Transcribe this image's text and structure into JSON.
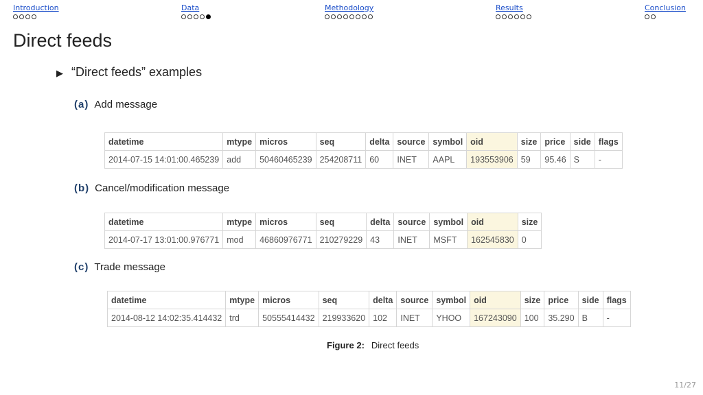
{
  "nav": [
    {
      "label": "Introduction",
      "dots": 4,
      "active": -1
    },
    {
      "label": "Data",
      "dots": 5,
      "active": 4
    },
    {
      "label": "Methodology",
      "dots": 8,
      "active": -1
    },
    {
      "label": "Results",
      "dots": 6,
      "active": -1
    },
    {
      "label": "Conclusion",
      "dots": 2,
      "active": -1
    }
  ],
  "frame_title": "Direct feeds",
  "bullet": "“Direct feeds” examples",
  "subfigs": [
    {
      "label": "(a)",
      "title": "Add  message",
      "columns": [
        "datetime",
        "mtype",
        "micros",
        "seq",
        "delta",
        "source",
        "symbol",
        "oid",
        "size",
        "price",
        "side",
        "flags"
      ],
      "row": [
        "2014-07-15 14:01:00.465239",
        "add",
        "50460465239",
        "254208711",
        "60",
        "INET",
        "AAPL",
        "193553906",
        "59",
        "95.46",
        "S",
        "-"
      ]
    },
    {
      "label": "(b)",
      "title": "Cancel/modification   message",
      "columns": [
        "datetime",
        "mtype",
        "micros",
        "seq",
        "delta",
        "source",
        "symbol",
        "oid",
        "size"
      ],
      "row": [
        "2014-07-17 13:01:00.976771",
        "mod",
        "46860976771",
        "210279229",
        "43",
        "INET",
        "MSFT",
        "162545830",
        "0"
      ]
    },
    {
      "label": "(c)",
      "title": "Trade  message",
      "columns": [
        "datetime",
        "mtype",
        "micros",
        "seq",
        "delta",
        "source",
        "symbol",
        "oid",
        "size",
        "price",
        "side",
        "flags"
      ],
      "row": [
        "2014-08-12 14:02:35.414432",
        "trd",
        "50555414432",
        "219933620",
        "102",
        "INET",
        "YHOO",
        "167243090",
        "100",
        "35.290",
        "B",
        "-"
      ]
    }
  ],
  "caption": {
    "label": "Figure  2:",
    "text": "Direct   feeds"
  },
  "page": "11/27",
  "colors": {
    "link": "#1a4dc9",
    "highlight": "#fbf6df",
    "label": "#1f3f6a"
  }
}
